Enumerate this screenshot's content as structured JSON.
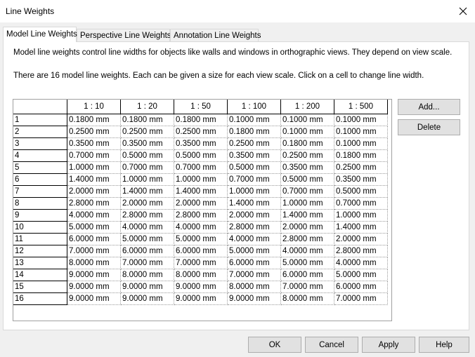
{
  "window": {
    "title": "Line Weights"
  },
  "tabs": [
    {
      "label": "Model Line Weights",
      "active": true
    },
    {
      "label": "Perspective Line Weights",
      "active": false
    },
    {
      "label": "Annotation Line Weights",
      "active": false
    }
  ],
  "description": {
    "line1": "Model line weights control line widths for objects like walls and windows in orthographic views. They depend on view scale.",
    "line2": "There are 16 model line weights. Each can be given a size for each view scale. Click on a cell to change line width."
  },
  "table": {
    "columns": [
      "1 : 10",
      "1 : 20",
      "1 : 50",
      "1 : 100",
      "1 : 200",
      "1 : 500"
    ],
    "rows": [
      {
        "id": "1",
        "values": [
          "0.1800 mm",
          "0.1800 mm",
          "0.1800 mm",
          "0.1000 mm",
          "0.1000 mm",
          "0.1000 mm"
        ]
      },
      {
        "id": "2",
        "values": [
          "0.2500 mm",
          "0.2500 mm",
          "0.2500 mm",
          "0.1800 mm",
          "0.1000 mm",
          "0.1000 mm"
        ]
      },
      {
        "id": "3",
        "values": [
          "0.3500 mm",
          "0.3500 mm",
          "0.3500 mm",
          "0.2500 mm",
          "0.1800 mm",
          "0.1000 mm"
        ]
      },
      {
        "id": "4",
        "values": [
          "0.7000 mm",
          "0.5000 mm",
          "0.5000 mm",
          "0.3500 mm",
          "0.2500 mm",
          "0.1800 mm"
        ]
      },
      {
        "id": "5",
        "values": [
          "1.0000 mm",
          "0.7000 mm",
          "0.7000 mm",
          "0.5000 mm",
          "0.3500 mm",
          "0.2500 mm"
        ]
      },
      {
        "id": "6",
        "values": [
          "1.4000 mm",
          "1.0000 mm",
          "1.0000 mm",
          "0.7000 mm",
          "0.5000 mm",
          "0.3500 mm"
        ]
      },
      {
        "id": "7",
        "values": [
          "2.0000 mm",
          "1.4000 mm",
          "1.4000 mm",
          "1.0000 mm",
          "0.7000 mm",
          "0.5000 mm"
        ]
      },
      {
        "id": "8",
        "values": [
          "2.8000 mm",
          "2.0000 mm",
          "2.0000 mm",
          "1.4000 mm",
          "1.0000 mm",
          "0.7000 mm"
        ]
      },
      {
        "id": "9",
        "values": [
          "4.0000 mm",
          "2.8000 mm",
          "2.8000 mm",
          "2.0000 mm",
          "1.4000 mm",
          "1.0000 mm"
        ]
      },
      {
        "id": "10",
        "values": [
          "5.0000 mm",
          "4.0000 mm",
          "4.0000 mm",
          "2.8000 mm",
          "2.0000 mm",
          "1.4000 mm"
        ]
      },
      {
        "id": "11",
        "values": [
          "6.0000 mm",
          "5.0000 mm",
          "5.0000 mm",
          "4.0000 mm",
          "2.8000 mm",
          "2.0000 mm"
        ]
      },
      {
        "id": "12",
        "values": [
          "7.0000 mm",
          "6.0000 mm",
          "6.0000 mm",
          "5.0000 mm",
          "4.0000 mm",
          "2.8000 mm"
        ]
      },
      {
        "id": "13",
        "values": [
          "8.0000 mm",
          "7.0000 mm",
          "7.0000 mm",
          "6.0000 mm",
          "5.0000 mm",
          "4.0000 mm"
        ]
      },
      {
        "id": "14",
        "values": [
          "9.0000 mm",
          "8.0000 mm",
          "8.0000 mm",
          "7.0000 mm",
          "6.0000 mm",
          "5.0000 mm"
        ]
      },
      {
        "id": "15",
        "values": [
          "9.0000 mm",
          "9.0000 mm",
          "9.0000 mm",
          "8.0000 mm",
          "7.0000 mm",
          "6.0000 mm"
        ]
      },
      {
        "id": "16",
        "values": [
          "9.0000 mm",
          "9.0000 mm",
          "9.0000 mm",
          "9.0000 mm",
          "8.0000 mm",
          "7.0000 mm"
        ]
      }
    ]
  },
  "side_buttons": {
    "add": "Add...",
    "delete": "Delete"
  },
  "footer_buttons": {
    "ok": "OK",
    "cancel": "Cancel",
    "apply": "Apply",
    "help": "Help"
  },
  "icons": {
    "close": "close-icon"
  }
}
